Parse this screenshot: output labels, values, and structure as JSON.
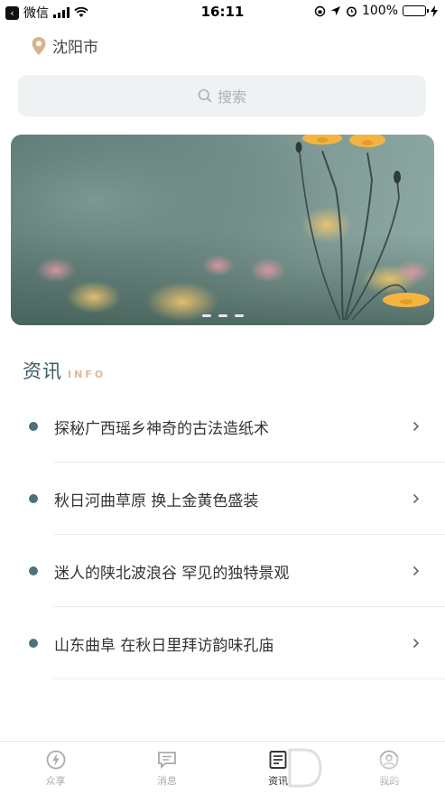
{
  "status_bar": {
    "back_app": "微信",
    "time": "16:11",
    "battery": "100%"
  },
  "location": {
    "city": "沈阳市"
  },
  "search": {
    "placeholder": "搜索"
  },
  "banner": {
    "slide_count": 3,
    "active_slide": 1
  },
  "section": {
    "title": "资讯",
    "subtitle": "INFO"
  },
  "news": [
    {
      "title": "探秘广西瑶乡神奇的古法造纸术"
    },
    {
      "title": "秋日河曲草原 换上金黄色盛装"
    },
    {
      "title": "迷人的陕北波浪谷 罕见的独特景观"
    },
    {
      "title": "山东曲阜 在秋日里拜访韵味孔庙"
    }
  ],
  "tabbar": {
    "items": [
      {
        "label": "众享",
        "icon": "lightning-icon"
      },
      {
        "label": "消息",
        "icon": "message-icon"
      },
      {
        "label": "资讯",
        "icon": "news-icon"
      },
      {
        "label": "我的",
        "icon": "profile-icon"
      }
    ],
    "active": "资讯"
  },
  "colors": {
    "accent": "#3c5c63",
    "bullet": "#4d7279",
    "info_sub": "#e0b79a",
    "search_bg": "#eef2f3"
  }
}
